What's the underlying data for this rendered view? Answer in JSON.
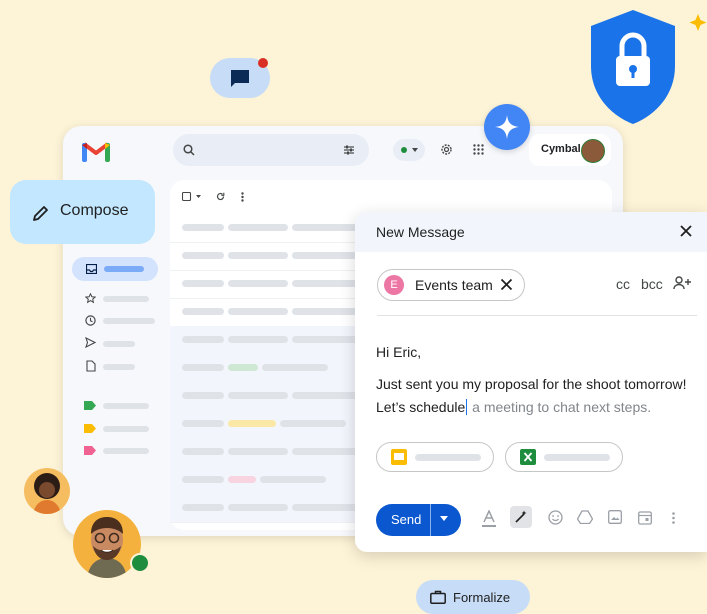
{
  "compose": {
    "label": "Compose"
  },
  "header": {
    "brand_chip": "Cymbal"
  },
  "dialog": {
    "title": "New Message",
    "recipient": {
      "initial": "E",
      "name": "Events team"
    },
    "cc_label": "cc",
    "bcc_label": "bcc",
    "greeting": "Hi Eric,",
    "line1": "Just sent you my proposal for the shoot tomorrow!",
    "line2_typed": "Let’s schedule",
    "line2_suggestion": " a meeting to chat next steps.",
    "send_label": "Send"
  },
  "formalize": {
    "label": "Formalize"
  },
  "colors": {
    "background": "#fdf3d7",
    "accent_blue": "#0b57d0",
    "compose_bg": "#c2e7ff",
    "notification_red": "#d93025",
    "online_green": "#1e8e3e"
  },
  "icons": {
    "chat": "chat-icon",
    "gemini": "sparkle-icon",
    "shield": "lock-shield-icon",
    "search": "search-icon",
    "filter": "tune-icon",
    "settings": "gear-icon",
    "apps": "apps-grid-icon",
    "compose": "pencil-icon",
    "close": "close-icon",
    "add_recipients": "person-add-icon"
  }
}
